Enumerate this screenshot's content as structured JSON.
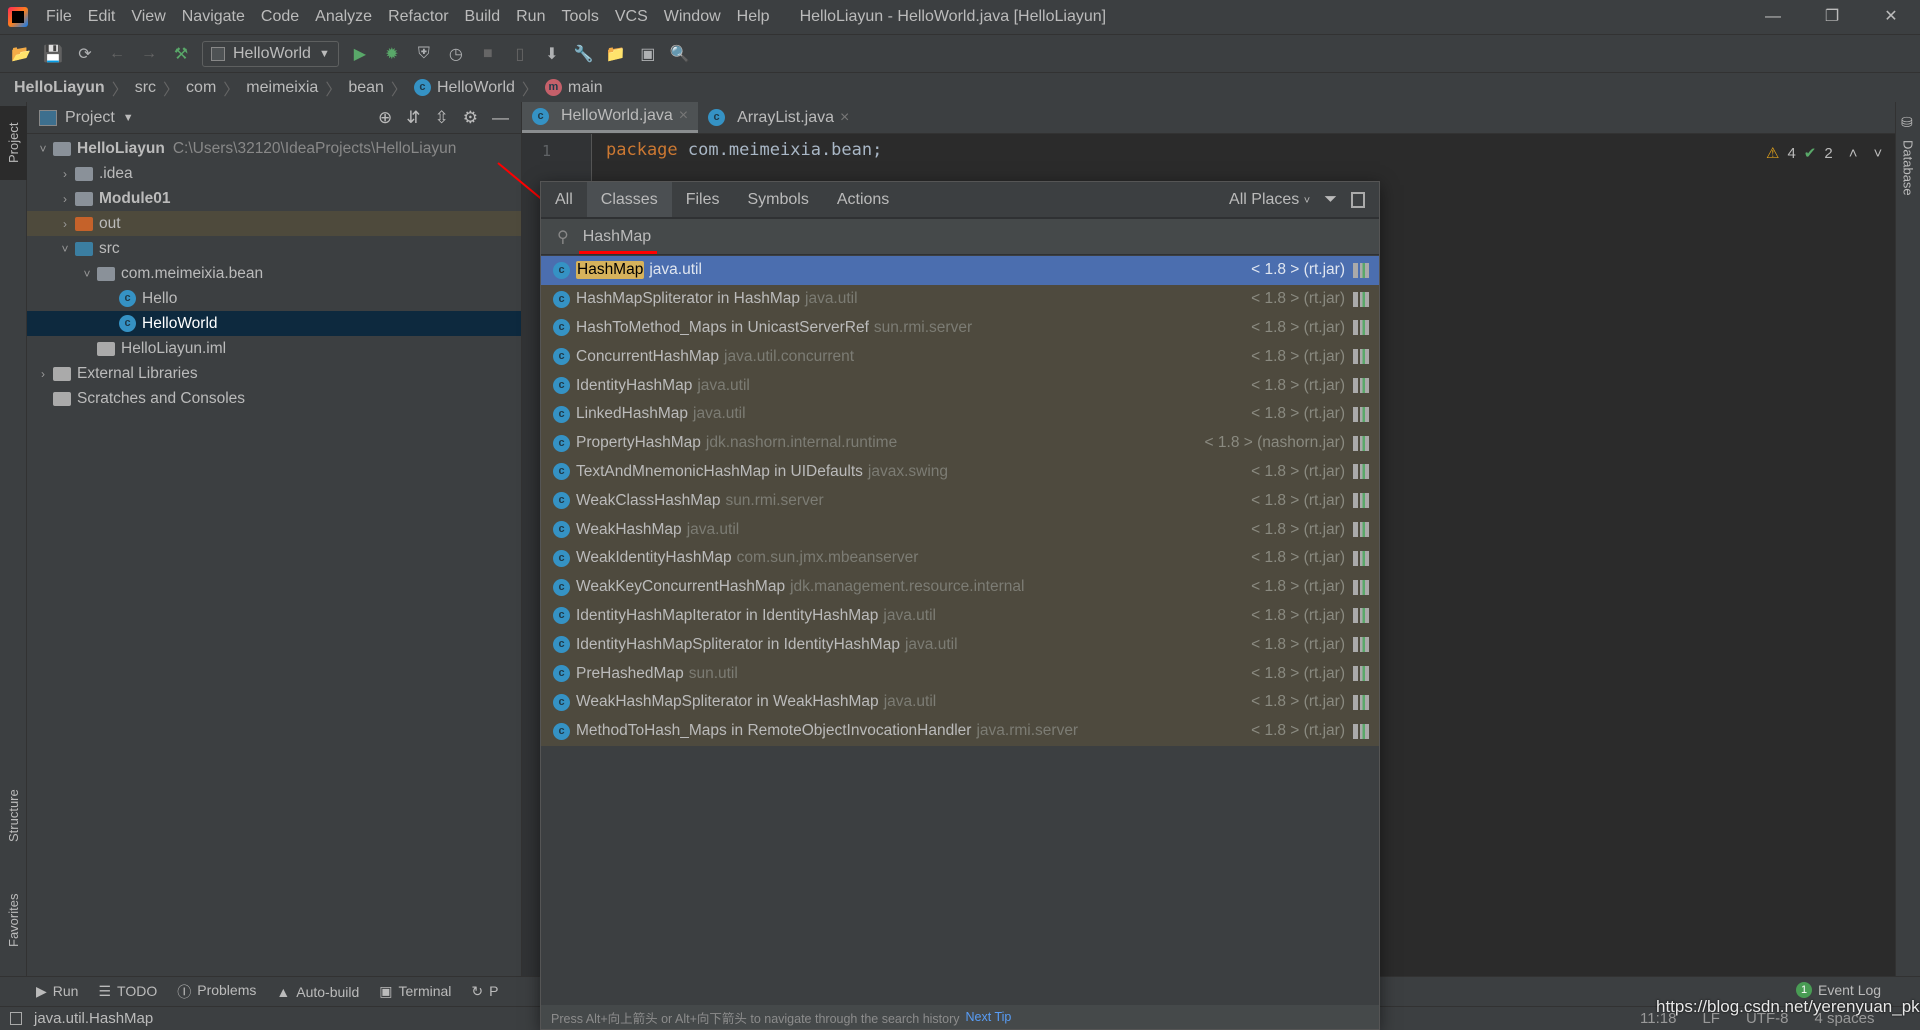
{
  "window": {
    "title": "HelloLiayun - HelloWorld.java [HelloLiayun]"
  },
  "menu": [
    "File",
    "Edit",
    "View",
    "Navigate",
    "Code",
    "Analyze",
    "Refactor",
    "Build",
    "Run",
    "Tools",
    "VCS",
    "Window",
    "Help"
  ],
  "toolbar": {
    "run_config": "HelloWorld"
  },
  "breadcrumb": [
    "HelloLiayun",
    "src",
    "com",
    "meimeixia",
    "bean",
    "HelloWorld",
    "main"
  ],
  "left_strip": {
    "project": "Project",
    "structure": "Structure",
    "favorites": "Favorites"
  },
  "right_strip": {
    "database": "Database"
  },
  "project": {
    "title": "Project",
    "tree": [
      {
        "label": "HelloLiayun",
        "path": "C:\\Users\\32120\\IdeaProjects\\HelloLiayun",
        "depth": 0,
        "arrow": "down",
        "icon": "module-folder",
        "bold": true
      },
      {
        "label": ".idea",
        "depth": 1,
        "arrow": "right",
        "icon": "folder"
      },
      {
        "label": "Module01",
        "depth": 1,
        "arrow": "right",
        "icon": "module-folder",
        "bold": true
      },
      {
        "label": "out",
        "depth": 1,
        "arrow": "right",
        "icon": "excluded-folder",
        "state": "out"
      },
      {
        "label": "src",
        "depth": 1,
        "arrow": "down",
        "icon": "source-folder"
      },
      {
        "label": "com.meimeixia.bean",
        "depth": 2,
        "arrow": "down",
        "icon": "package"
      },
      {
        "label": "Hello",
        "depth": 3,
        "icon": "class"
      },
      {
        "label": "HelloWorld",
        "depth": 3,
        "icon": "class",
        "state": "selected"
      },
      {
        "label": "HelloLiayun.iml",
        "depth": 2,
        "icon": "iml-file"
      },
      {
        "label": "External Libraries",
        "depth": 0,
        "arrow": "right",
        "icon": "libraries"
      },
      {
        "label": "Scratches and Consoles",
        "depth": 0,
        "icon": "scratches"
      }
    ]
  },
  "editor": {
    "tabs": [
      {
        "label": "HelloWorld.java",
        "active": true
      },
      {
        "label": "ArrayList.java"
      }
    ],
    "line1_keyword": "package",
    "line1_rest": " com.meimeixia.bean;",
    "line_number": "1",
    "warnings": "4",
    "checks": "2"
  },
  "popup": {
    "tabs": [
      "All",
      "Classes",
      "Files",
      "Symbols",
      "Actions"
    ],
    "active_tab": "Classes",
    "scope": "All Places",
    "query": "HashMap",
    "results": [
      {
        "name": "HashMap",
        "pkg": "java.util",
        "loc": "< 1.8 > (rt.jar)",
        "selected": true,
        "highlight": true
      },
      {
        "name": "HashMapSpliterator in HashMap",
        "pkg": "java.util",
        "loc": "< 1.8 > (rt.jar)"
      },
      {
        "name": "HashToMethod_Maps in UnicastServerRef",
        "pkg": "sun.rmi.server",
        "loc": "< 1.8 > (rt.jar)"
      },
      {
        "name": "ConcurrentHashMap",
        "pkg": "java.util.concurrent",
        "loc": "< 1.8 > (rt.jar)"
      },
      {
        "name": "IdentityHashMap",
        "pkg": "java.util",
        "loc": "< 1.8 > (rt.jar)"
      },
      {
        "name": "LinkedHashMap",
        "pkg": "java.util",
        "loc": "< 1.8 > (rt.jar)"
      },
      {
        "name": "PropertyHashMap",
        "pkg": "jdk.nashorn.internal.runtime",
        "loc": "< 1.8 > (nashorn.jar)"
      },
      {
        "name": "TextAndMnemonicHashMap in UIDefaults",
        "pkg": "javax.swing",
        "loc": "< 1.8 > (rt.jar)"
      },
      {
        "name": "WeakClassHashMap",
        "pkg": "sun.rmi.server",
        "loc": "< 1.8 > (rt.jar)"
      },
      {
        "name": "WeakHashMap",
        "pkg": "java.util",
        "loc": "< 1.8 > (rt.jar)"
      },
      {
        "name": "WeakIdentityHashMap",
        "pkg": "com.sun.jmx.mbeanserver",
        "loc": "< 1.8 > (rt.jar)"
      },
      {
        "name": "WeakKeyConcurrentHashMap",
        "pkg": "jdk.management.resource.internal",
        "loc": "< 1.8 > (rt.jar)"
      },
      {
        "name": "IdentityHashMapIterator in IdentityHashMap",
        "pkg": "java.util",
        "loc": "< 1.8 > (rt.jar)"
      },
      {
        "name": "IdentityHashMapSpliterator in IdentityHashMap",
        "pkg": "java.util",
        "loc": "< 1.8 > (rt.jar)"
      },
      {
        "name": "PreHashedMap",
        "pkg": "sun.util",
        "loc": "< 1.8 > (rt.jar)"
      },
      {
        "name": "WeakHashMapSpliterator in WeakHashMap",
        "pkg": "java.util",
        "loc": "< 1.8 > (rt.jar)"
      },
      {
        "name": "MethodToHash_Maps in RemoteObjectInvocationHandler",
        "pkg": "java.rmi.server",
        "loc": "< 1.8 > (rt.jar)"
      }
    ],
    "hint": "Press Alt+向上箭头 or Alt+向下箭头 to navigate through the search history",
    "next_tip": "Next Tip"
  },
  "bottom_tools": [
    "Run",
    "TODO",
    "Problems",
    "Auto-build",
    "Terminal",
    "P"
  ],
  "event_log": {
    "count": "1",
    "label": "Event Log"
  },
  "status": {
    "message": "java.util.HashMap",
    "position": "11:18",
    "line_sep": "LF",
    "encoding": "UTF-8",
    "indent": "4 spaces",
    "watermark": "https://blog.csdn.net/yerenyuan_pku"
  },
  "colors": {
    "selection": "#4b6eaf",
    "match_highlight": "#d6b25b",
    "keyword": "#cc7832",
    "annotation_arrow": "#ff0000"
  }
}
